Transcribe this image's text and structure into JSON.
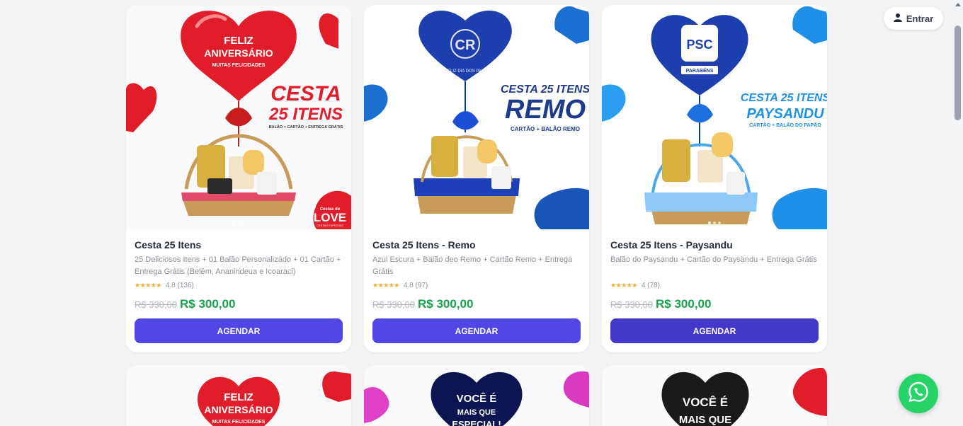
{
  "header": {
    "login_label": "Entrar"
  },
  "products": [
    {
      "title": "Cesta 25 Itens",
      "description": "25 Deliciosos Itens + 01 Balão Personalizado + 01 Cartão + Entrega Grátis (Belém, Ananindeua e Icoaraci)",
      "stars": "★★★★★",
      "rating": "4.8 (136)",
      "old_price": "R$ 330,00",
      "price": "R$ 300,00",
      "button": "AGENDAR",
      "image": {
        "balloon_line1": "FELIZ",
        "balloon_line2": "ANIVERSÁRIO",
        "balloon_line3": "MUITAS FELICIDADES",
        "headline1": "CESTA",
        "headline2": "25 ITENS",
        "caption": "BALÃO + CARTÃO + ENTREGA GRÁTIS",
        "logo_small": "Cestas de",
        "logo": "LOVE",
        "logo_sub": "CESTAS ESPECIAIS",
        "accent": "#e11d2a"
      }
    },
    {
      "title": "Cesta 25 Itens - Remo",
      "description": "Azul Escura + Balão deo Remo + Cartão Remo + Entrega Grátis",
      "stars": "★★★★★",
      "rating": "4.8 (97)",
      "old_price": "R$ 330,00",
      "price": "R$ 300,00",
      "button": "AGENDAR",
      "image": {
        "balloon_text": "FELIZ DIA DOS PAIS",
        "headline1": "CESTA 25 ITENS",
        "headline2": "REMO",
        "caption": "CARTÃO + BALÃO REMO",
        "accent": "#1d4ed8"
      }
    },
    {
      "title": "Cesta 25 Itens - Paysandu",
      "description": "Balão do Paysandu + Cartão do Paysandu + Entrega Grátis",
      "stars": "★★★★★",
      "rating": "4 (78)",
      "old_price": "R$ 330,00",
      "price": "R$ 300,00",
      "button": "AGENDAR",
      "image": {
        "balloon_text": "PARABÉNS",
        "headline1": "CESTA 25 ITENS",
        "headline2": "PAYSANDU",
        "caption": "CARTÃO + BALÃO DO PAPÃO",
        "accent": "#1e90e8"
      }
    }
  ],
  "partial_cards": [
    {
      "balloon_line1": "FELIZ",
      "balloon_line2": "ANIVERSÁRIO",
      "balloon_line3": "MUITAS FELICIDADES"
    },
    {
      "balloon_line1": "VOCÊ É",
      "balloon_line2": "MAIS QUE",
      "balloon_line3": "ESPECIAL!"
    },
    {
      "balloon_line1": "VOCÊ É",
      "balloon_line2": "MAIS QUE"
    }
  ],
  "colors": {
    "button": "#4f46e5",
    "price": "#16a34a",
    "whatsapp": "#25d366"
  },
  "icons": {
    "login": "user-icon",
    "whatsapp": "whatsapp-icon"
  }
}
